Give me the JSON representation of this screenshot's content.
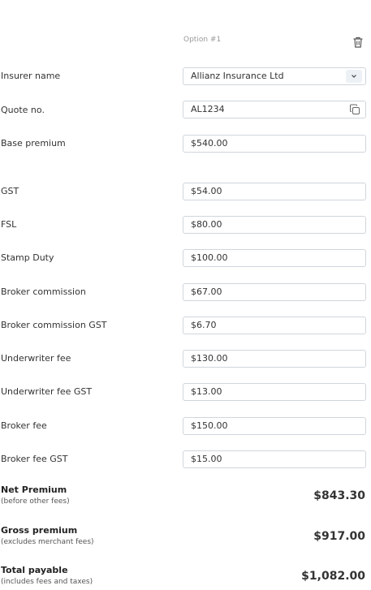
{
  "option": {
    "label": "Option #1",
    "delete_icon": "trash-icon"
  },
  "fields": [
    {
      "label": "Insurer name",
      "value": "Allianz Insurance Ltd",
      "type": "select"
    },
    {
      "label": "Quote no.",
      "value": "AL1234",
      "type": "copy"
    },
    {
      "label": "Base premium",
      "value": "$540.00",
      "type": "text"
    },
    {
      "label": "GST",
      "value": "$54.00",
      "type": "text"
    },
    {
      "label": "FSL",
      "value": "$80.00",
      "type": "text"
    },
    {
      "label": "Stamp Duty",
      "value": "$100.00",
      "type": "text"
    },
    {
      "label": "Broker commission",
      "value": "$67.00",
      "type": "text"
    },
    {
      "label": "Broker commission GST",
      "value": "$6.70",
      "type": "text"
    },
    {
      "label": "Underwriter fee",
      "value": "$130.00",
      "type": "text"
    },
    {
      "label": "Underwriter fee GST",
      "value": "$13.00",
      "type": "text"
    },
    {
      "label": "Broker fee",
      "value": "$150.00",
      "type": "text"
    },
    {
      "label": "Broker fee GST",
      "value": "$15.00",
      "type": "text"
    }
  ],
  "summary": [
    {
      "label": "Net Premium",
      "sub": "(before other fees)",
      "value": "$843.30"
    },
    {
      "label": "Gross premium",
      "sub": "(excludes merchant fees)",
      "value": "$917.00"
    },
    {
      "label": "Total payable",
      "sub": "(includes fees and taxes)",
      "value": "$1,082.00"
    }
  ]
}
